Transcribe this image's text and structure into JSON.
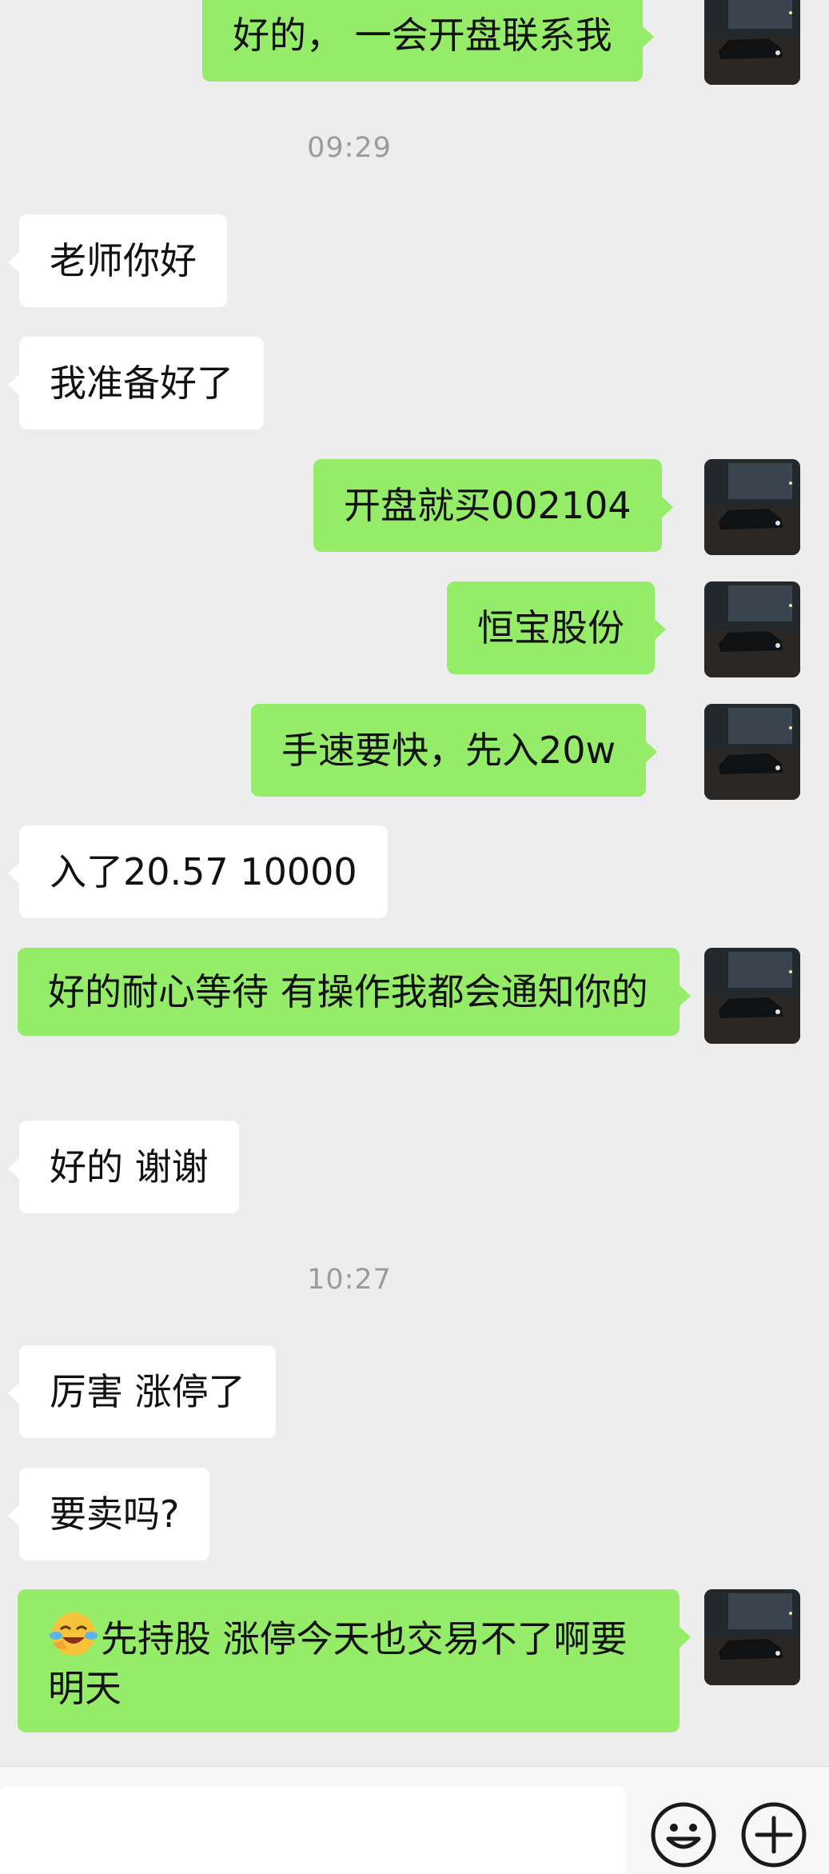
{
  "messages": [
    {
      "id": "m1",
      "side": "out",
      "text": "好的， 一会开盘联系我"
    },
    {
      "id": "t1",
      "type": "time",
      "text": "09:29"
    },
    {
      "id": "m2",
      "side": "in",
      "text": "老师你好"
    },
    {
      "id": "m3",
      "side": "in",
      "text": "我准备好了"
    },
    {
      "id": "m4",
      "side": "out",
      "text": "开盘就买002104"
    },
    {
      "id": "m5",
      "side": "out",
      "text": "恒宝股份"
    },
    {
      "id": "m6",
      "side": "out",
      "text": "手速要快，先入20w"
    },
    {
      "id": "m7",
      "side": "in",
      "text": "入了20.57 10000"
    },
    {
      "id": "m8",
      "side": "out",
      "text": "好的耐心等待 有操作我都会通知你的"
    },
    {
      "id": "m9",
      "side": "in",
      "text": "好的 谢谢"
    },
    {
      "id": "t2",
      "type": "time",
      "text": "10:27"
    },
    {
      "id": "m10",
      "side": "in",
      "text": "厉害 涨停了"
    },
    {
      "id": "m11",
      "side": "in",
      "text": "要卖吗?"
    },
    {
      "id": "m12",
      "side": "out",
      "emoji": "face-with-tears-of-joy",
      "text": "先持股 涨停今天也交易不了啊要明天"
    }
  ],
  "input": {
    "value": "",
    "placeholder": ""
  },
  "icons": {
    "emoji_button": "smiley-face-icon",
    "more_button": "plus-circle-icon"
  },
  "colors": {
    "background": "#ededed",
    "incoming_bubble": "#ffffff",
    "outgoing_bubble": "#95ec69",
    "timestamp": "#9b9b9b"
  }
}
